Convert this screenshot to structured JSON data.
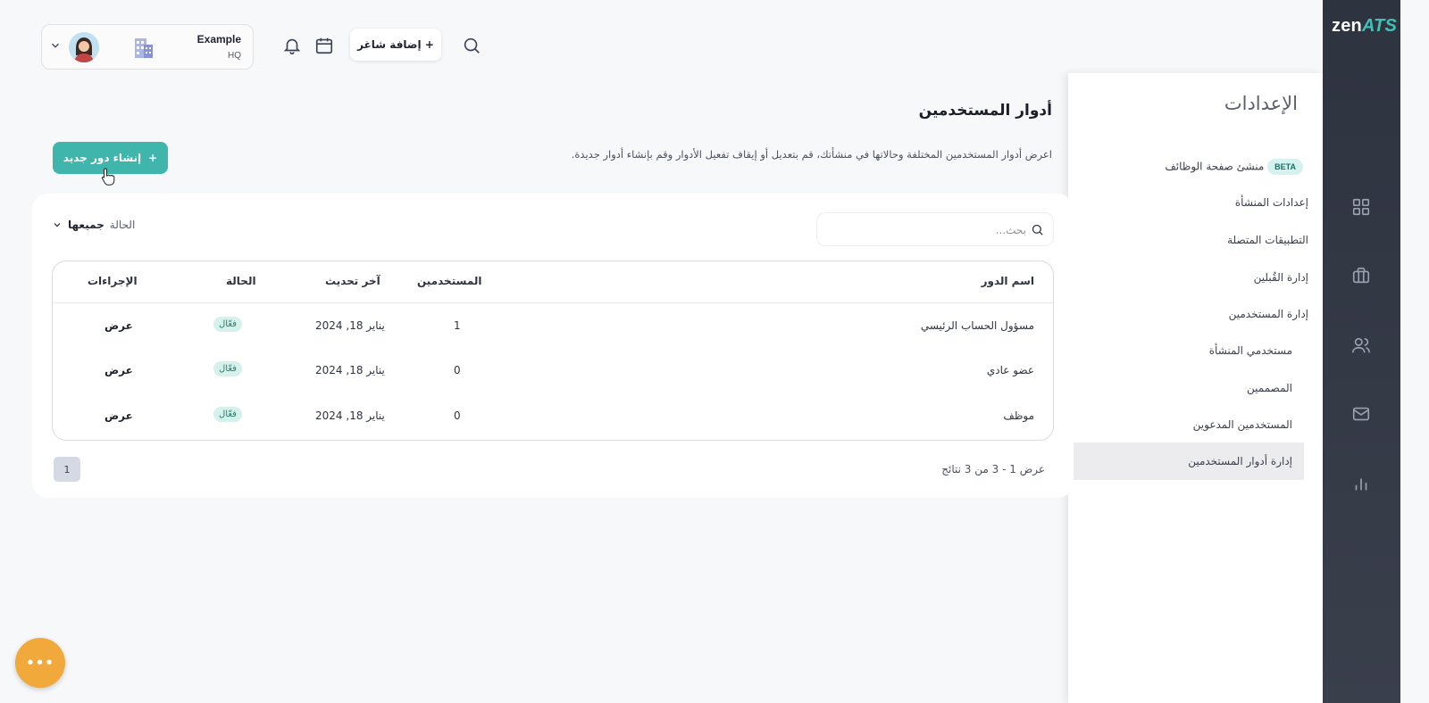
{
  "brand": {
    "name_main": "zen",
    "name_accent": "ATS"
  },
  "rail": {
    "icons": [
      "dashboard-icon",
      "briefcase-icon",
      "users-icon",
      "mail-icon",
      "bar-chart-icon"
    ]
  },
  "settings": {
    "title": "الإعدادات",
    "beta_badge": "BETA",
    "items": [
      {
        "label": "منشئ صفحة الوظائف"
      },
      {
        "label": "إعدادات المنشأة"
      },
      {
        "label": "التطبيقات المتصلة"
      },
      {
        "label": "إدارة القُبلين"
      },
      {
        "label": "إدارة المستخدمين"
      },
      {
        "label": "مستخدمي المنشأة"
      },
      {
        "label": "المصممين"
      },
      {
        "label": "المستخدمين المدعوين"
      },
      {
        "label": "إدارة أدوار المستخدمين"
      }
    ]
  },
  "header": {
    "account_name": "Example",
    "account_sub": "HQ",
    "add_job_label": "+ إضافة شاغر"
  },
  "page": {
    "title": "أدوار المستخدمين",
    "description": "اعرض أدوار المستخدمين المختلفة وحالاتها في منشأتك، قم بتعديل أو إيقاف تفعيل الأدوار وقم بإنشاء أدوار جديدة.",
    "create_button": "إنشاء دور جديد",
    "create_plus": "+"
  },
  "filters": {
    "search_placeholder": "بحث...",
    "status_label": "الحالة",
    "status_value": "جميعها"
  },
  "table": {
    "headers": {
      "role": "اسم الدور",
      "users": "المستخدمين",
      "updated": "آخر تحديث",
      "status": "الحالة",
      "actions": "الإجراءات"
    },
    "rows": [
      {
        "role": "مسؤول الحساب الرئيسي",
        "users": "1",
        "updated": "يناير 18, 2024",
        "status": "فعّال",
        "action": "عرض"
      },
      {
        "role": "عضو عادي",
        "users": "0",
        "updated": "يناير 18, 2024",
        "status": "فعّال",
        "action": "عرض"
      },
      {
        "role": "موظف",
        "users": "0",
        "updated": "يناير 18, 2024",
        "status": "فعّال",
        "action": "عرض"
      }
    ]
  },
  "pagination": {
    "results_text": "عرض 1 - 3 من 3 نتائج",
    "current_page": "1"
  },
  "fab": {
    "label": "•••"
  }
}
